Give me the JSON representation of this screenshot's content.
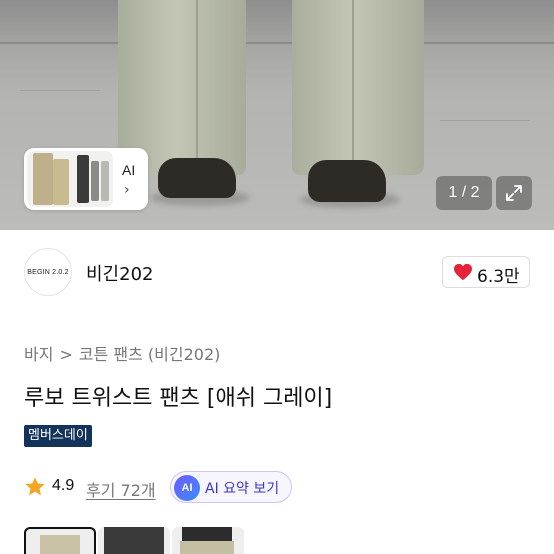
{
  "gallery": {
    "page_current": "1",
    "page_total": "2",
    "page_text": "1 / 2",
    "ai_card_label": "AI",
    "ai_card_arrow": "›",
    "expand_icon": "expand-icon"
  },
  "brand": {
    "logo_text": "BEGIN 2.0.2",
    "name": "비긴202",
    "likes": "6.3만",
    "heart_color": "#e5243b"
  },
  "breadcrumb": {
    "items": [
      "바지",
      "코튼 팬츠 (비긴202)"
    ],
    "separator": ">"
  },
  "product": {
    "title": "루보 트위스트 팬츠 [애쉬 그레이]",
    "badge": "멤버스데이",
    "badge_color": "#13335a"
  },
  "rating": {
    "score": "4.9",
    "reviews": "후기 72개",
    "ai_chip": "AI",
    "ai_summary": "AI 요약 보기",
    "star_color": "#f5a623"
  },
  "thumbnails": {
    "selected_index": 0,
    "count_visible": 3
  }
}
